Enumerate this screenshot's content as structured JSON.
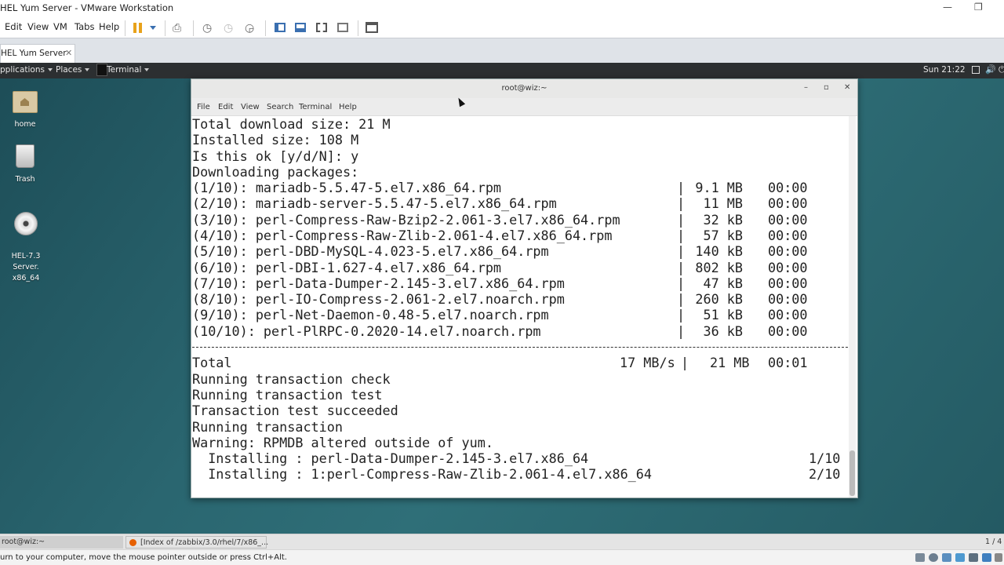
{
  "host": {
    "title": "HEL Yum Server - VMware Workstation",
    "window_buttons": {
      "minimize": "—",
      "restore": "❐"
    },
    "menu": [
      "Edit",
      "View",
      "VM",
      "Tabs",
      "Help"
    ],
    "tab_label": "HEL Yum Server",
    "tab_close": "✕",
    "status_text": "urn to your computer, move the mouse pointer outside or press Ctrl+Alt.",
    "taskbar": {
      "left": "root@wiz:~",
      "browser": "[Index of /zabbix/3.0/rhel/7/x86_...",
      "right": "1 / 4"
    },
    "accent": "#2f6f78"
  },
  "guest": {
    "topbar": {
      "applications": "pplications",
      "places": "Places",
      "terminal": "Terminal",
      "clock": "Sun 21:22"
    },
    "desktop_icons": [
      {
        "label": "home",
        "icon": "folder-home-icon"
      },
      {
        "label": "Trash",
        "icon": "trash-icon"
      },
      {
        "label": "HEL-7.3 Server.\nx86_64",
        "icon": "disc-icon"
      }
    ]
  },
  "terminal": {
    "title": "root@wiz:~",
    "buttons": {
      "minimize": "–",
      "maximize": "▫",
      "close": "✕"
    },
    "menu": [
      "File",
      "Edit",
      "View",
      "Search",
      "Terminal",
      "Help"
    ],
    "summary_lines": [
      "Total download size: 21 M",
      "Installed size: 108 M",
      "Is this ok [y/d/N]: y",
      "Downloading packages:"
    ],
    "packages": [
      {
        "name": "(1/10): mariadb-5.5.47-5.el7.x86_64.rpm",
        "size": "9.1 MB",
        "time": "00:00"
      },
      {
        "name": "(2/10): mariadb-server-5.5.47-5.el7.x86_64.rpm",
        "size": "11 MB",
        "time": "00:00"
      },
      {
        "name": "(3/10): perl-Compress-Raw-Bzip2-2.061-3.el7.x86_64.rpm",
        "size": "32 kB",
        "time": "00:00"
      },
      {
        "name": "(4/10): perl-Compress-Raw-Zlib-2.061-4.el7.x86_64.rpm",
        "size": "57 kB",
        "time": "00:00"
      },
      {
        "name": "(5/10): perl-DBD-MySQL-4.023-5.el7.x86_64.rpm",
        "size": "140 kB",
        "time": "00:00"
      },
      {
        "name": "(6/10): perl-DBI-1.627-4.el7.x86_64.rpm",
        "size": "802 kB",
        "time": "00:00"
      },
      {
        "name": "(7/10): perl-Data-Dumper-2.145-3.el7.x86_64.rpm",
        "size": "47 kB",
        "time": "00:00"
      },
      {
        "name": "(8/10): perl-IO-Compress-2.061-2.el7.noarch.rpm",
        "size": "260 kB",
        "time": "00:00"
      },
      {
        "name": "(9/10): perl-Net-Daemon-0.48-5.el7.noarch.rpm",
        "size": "51 kB",
        "time": "00:00"
      },
      {
        "name": "(10/10): perl-PlRPC-0.2020-14.el7.noarch.rpm",
        "size": "36 kB",
        "time": "00:00"
      }
    ],
    "bar_char": "|",
    "total": {
      "label": "Total",
      "rate": "17 MB/s",
      "size": "21 MB",
      "time": "00:01"
    },
    "after_lines": [
      "Running transaction check",
      "Running transaction test",
      "Transaction test succeeded",
      "Running transaction",
      "Warning: RPMDB altered outside of yum."
    ],
    "installing": [
      {
        "text": "  Installing : perl-Data-Dumper-2.145-3.el7.x86_64",
        "progress": "1/10"
      },
      {
        "text": "  Installing : 1:perl-Compress-Raw-Zlib-2.061-4.el7.x86_64",
        "progress": "2/10"
      }
    ]
  }
}
